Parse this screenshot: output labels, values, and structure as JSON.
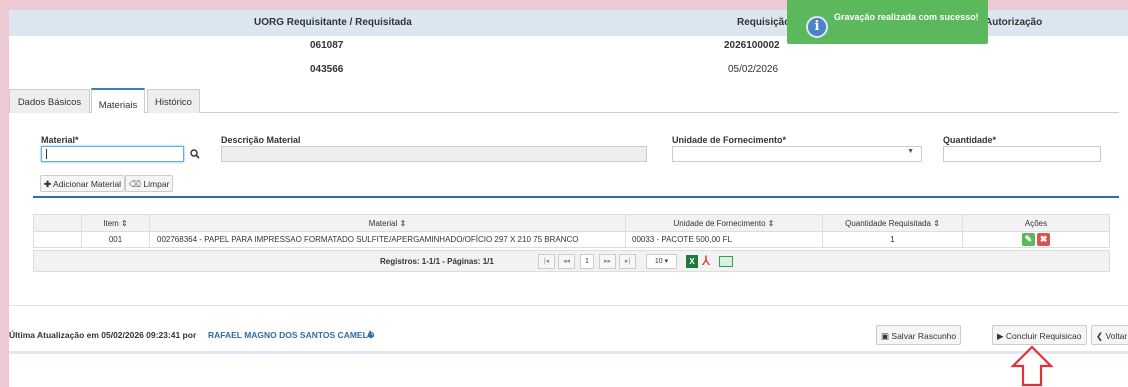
{
  "header": {
    "col1_label": "UORG Requisitante / Requisitada",
    "col2_label": "Requisição",
    "col3_label": "Autorização",
    "uorg_requisitante": "061087",
    "uorg_requisitada": "043566",
    "requisicao_numero": "2026100002",
    "requisicao_data": "05/02/2026"
  },
  "toast": {
    "message": "Gravação realizada com sucesso!",
    "icon": "info-icon",
    "color": "#5cb85c"
  },
  "tabs": [
    {
      "label": "Dados Básicos",
      "active": false
    },
    {
      "label": "Materiais",
      "active": true
    },
    {
      "label": "Histórico",
      "active": false
    }
  ],
  "form": {
    "material_label": "Material*",
    "material_value": "",
    "descricao_label": "Descrição Material",
    "unidade_label": "Unidade de Fornecimento*",
    "quantidade_label": "Quantidade*",
    "add_button": "Adicionar Material",
    "clear_button": "Limpar"
  },
  "table": {
    "columns": [
      "Item",
      "Material",
      "Unidade de Fornecimento",
      "Quantidade Requisitada",
      "Ações"
    ],
    "rows": [
      {
        "item": "001",
        "material": "002768364 - PAPEL PARA IMPRESSAO FORMATADO SULFITE/APERGAMINHADO/OFÍCIO 297 X 210 75 BRANCO",
        "unidade": "00033 - PACOTE 500,00 FL",
        "quantidade": "1"
      }
    ]
  },
  "pager": {
    "info": "Registros: 1-1/1 - Páginas: 1/1",
    "current_page": "1",
    "page_size": "10"
  },
  "footer": {
    "updated_prefix": "Última Atualização em 05/02/2026 09:23:41 por",
    "user": "RAFAEL MAGNO DOS SANTOS CAMELO",
    "save_draft": "Salvar Rascunho",
    "conclude": "Concluir Requisicao",
    "back": "Voltar"
  },
  "colors": {
    "accent": "#2e6da4",
    "success": "#5cb85c",
    "danger": "#d9534f",
    "annotation_arrow": "#e0303a"
  }
}
